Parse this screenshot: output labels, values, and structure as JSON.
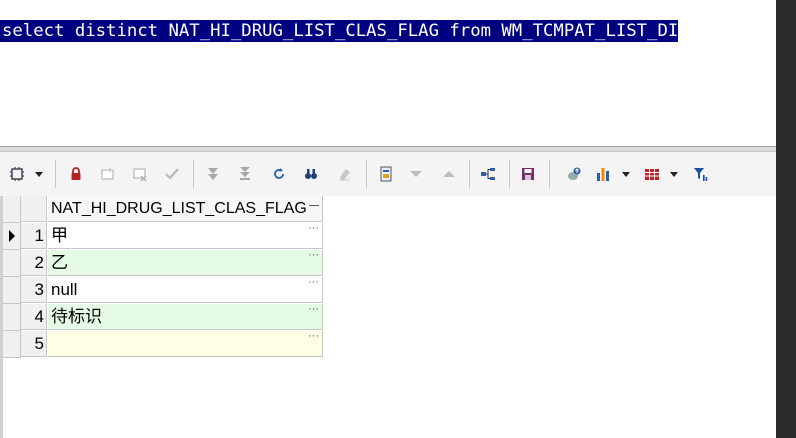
{
  "editor": {
    "sql_text": "select distinct NAT_HI_DRUG_LIST_CLAS_FLAG from WM_TCMPAT_LIST_DI"
  },
  "toolbar": {
    "buttons": [
      {
        "name": "grid-options-icon"
      },
      {
        "name": "lock-icon"
      },
      {
        "name": "insert-record-icon"
      },
      {
        "name": "delete-record-icon"
      },
      {
        "name": "post-changes-icon"
      },
      {
        "name": "fetch-next-icon"
      },
      {
        "name": "fetch-last-icon"
      },
      {
        "name": "refresh-icon"
      },
      {
        "name": "find-icon"
      },
      {
        "name": "clear-icon"
      },
      {
        "name": "query-by-example-icon"
      },
      {
        "name": "next-record-icon"
      },
      {
        "name": "previous-record-icon"
      },
      {
        "name": "tree-view-icon"
      },
      {
        "name": "save-icon"
      },
      {
        "name": "export-icon"
      },
      {
        "name": "chart-icon"
      },
      {
        "name": "table-view-icon"
      },
      {
        "name": "filter-icon"
      }
    ],
    "colors": {
      "lock": "#b22222",
      "save": "#7a2a6a",
      "chart_orange": "#f08c00",
      "chart_blue": "#2b5fa8",
      "table_red": "#c0202a",
      "filter_blue": "#1a4fa0"
    }
  },
  "grid": {
    "column_header": "NAT_HI_DRUG_LIST_CLAS_FLAG",
    "rows": [
      {
        "num": "1",
        "value": "甲"
      },
      {
        "num": "2",
        "value": "乙"
      },
      {
        "num": "3",
        "value": "null"
      },
      {
        "num": "4",
        "value": "待标识"
      },
      {
        "num": "5",
        "value": ""
      }
    ],
    "ellipsis": "···"
  }
}
